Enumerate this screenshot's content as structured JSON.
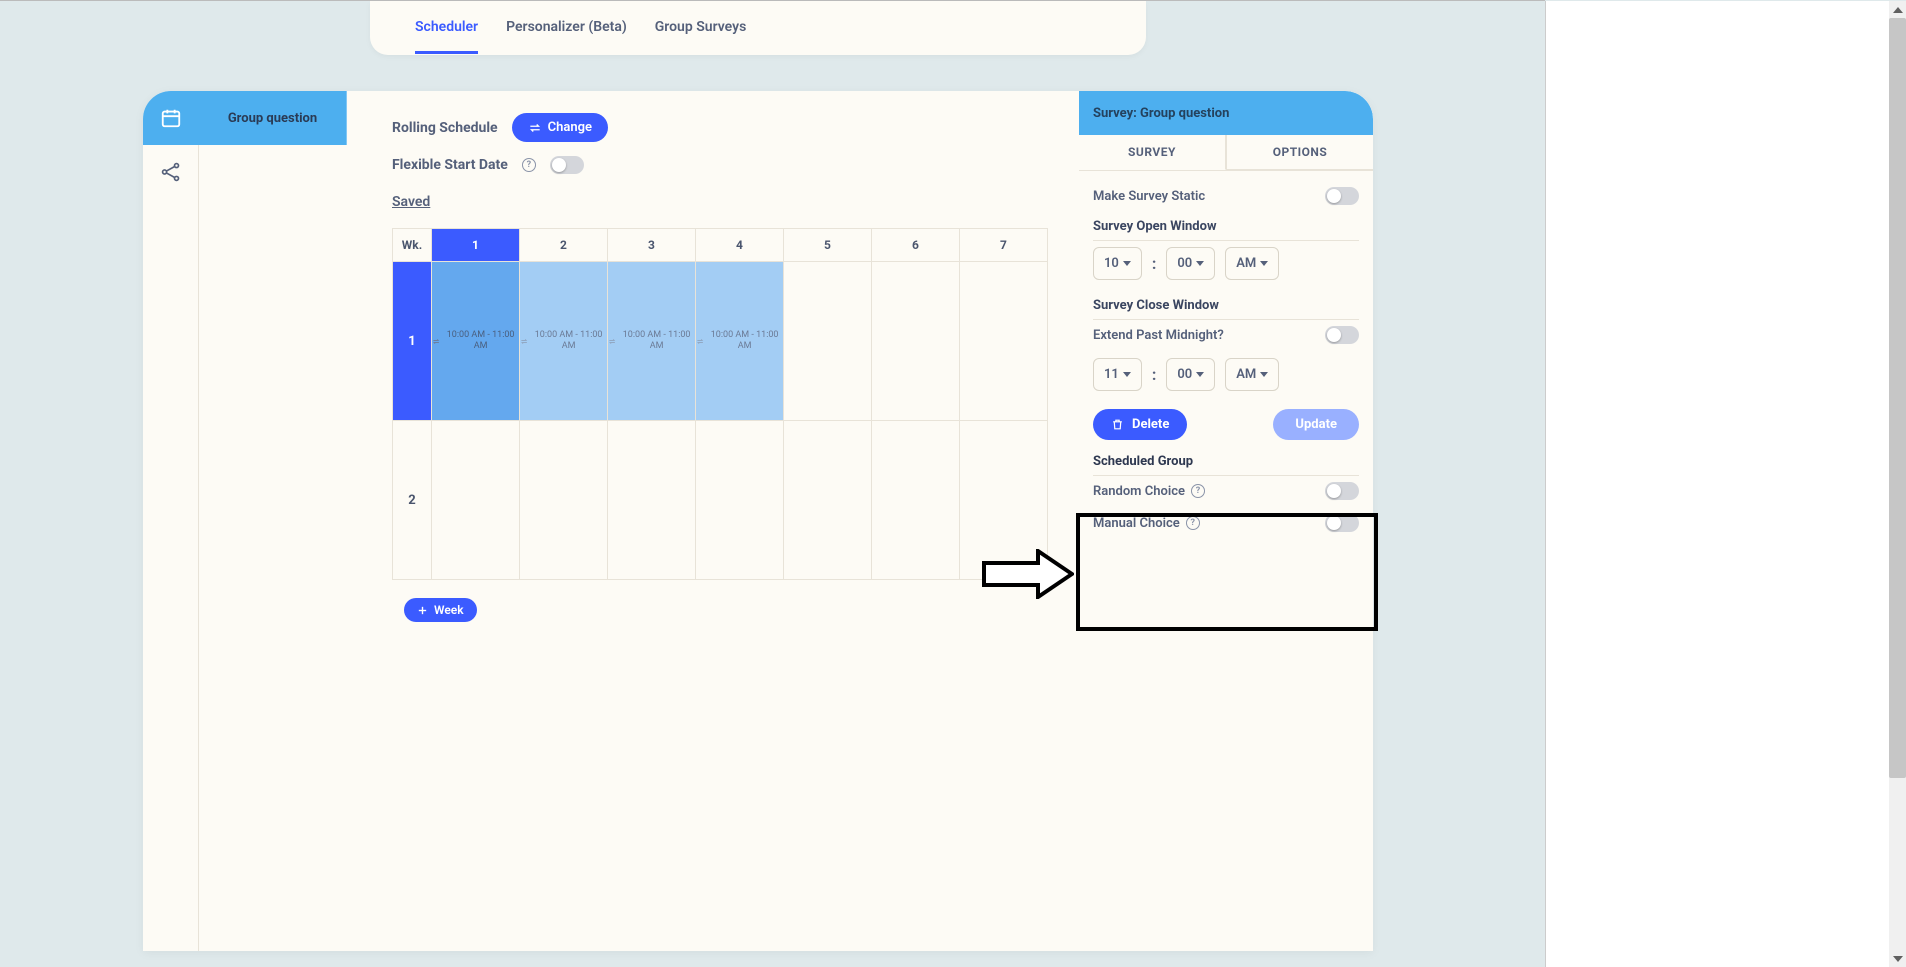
{
  "top_tabs": {
    "scheduler": "Scheduler",
    "personalizer": "Personalizer (Beta)",
    "group_surveys": "Group Surveys"
  },
  "sidebar": {
    "group_tab": "Group question"
  },
  "content": {
    "rolling_label": "Rolling Schedule",
    "change_btn": "Change",
    "flexible_start": "Flexible Start Date",
    "saved": "Saved",
    "week_header": "Wk.",
    "day_headers": [
      "1",
      "2",
      "3",
      "4",
      "5",
      "6",
      "7"
    ],
    "row_labels": [
      "1",
      "2"
    ],
    "slot_time": "10:00 AM - 11:00 AM",
    "add_week": "Week"
  },
  "right": {
    "header": "Survey: Group question",
    "tab_survey": "SURVEY",
    "tab_options": "OPTIONS",
    "make_static": "Make Survey Static",
    "open_window": "Survey Open Window",
    "open_hour": "10",
    "open_min": "00",
    "open_ampm": "AM",
    "close_window": "Survey Close Window",
    "extend_midnight": "Extend Past Midnight?",
    "close_hour": "11",
    "close_min": "00",
    "close_ampm": "AM",
    "delete": "Delete",
    "update": "Update",
    "scheduled_group": "Scheduled Group",
    "random_choice": "Random Choice",
    "manual_choice": "Manual Choice"
  }
}
